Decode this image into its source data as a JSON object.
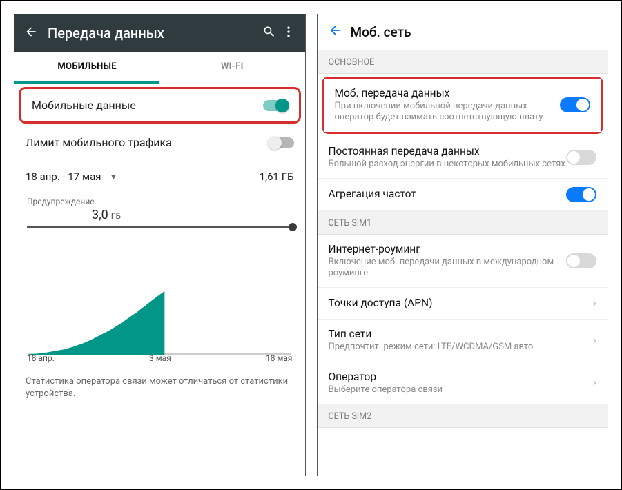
{
  "left": {
    "header": {
      "title": "Передача данных"
    },
    "tabs": {
      "mobile": "МОБИЛЬНЫЕ",
      "wifi": "WI-FI"
    },
    "mobileData": {
      "label": "Мобильные данные"
    },
    "limit": {
      "label": "Лимит мобильного трафика"
    },
    "cycle": {
      "range": "18 апр. - 17 мая",
      "usage": "1,61 ГБ"
    },
    "warning": {
      "label": "Предупреждение",
      "value": "3,0",
      "unit": "ГБ"
    },
    "axis": {
      "start": "18 апр.",
      "mid": "3 мая",
      "end": "18 мая"
    },
    "disclaimer": "Статистика оператора связи может отличаться от статистики устройства."
  },
  "right": {
    "header": {
      "title": "Моб. сеть"
    },
    "section_main": "ОСНОВНОЕ",
    "mobData": {
      "title": "Моб. передача данных",
      "sub": "При включении мобильной передачи данных оператор будет взимать соответствующую плату"
    },
    "alwaysOn": {
      "title": "Постоянная передача данных",
      "sub": "Большой расход энергии в некоторых мобильных сетях"
    },
    "aggregation": {
      "title": "Агрегация частот"
    },
    "section_sim1": "СЕТЬ SIM1",
    "roaming": {
      "title": "Интернет-роуминг",
      "sub": "Включение моб. передачи данных в международном роуминге"
    },
    "apn": {
      "title": "Точки доступа (APN)"
    },
    "netType": {
      "title": "Тип сети",
      "sub": "Предпочтит. режим сети: LTE/WCDMA/GSM авто"
    },
    "operator": {
      "title": "Оператор",
      "sub": "Выберите оператора связи"
    },
    "section_sim2": "СЕТЬ SIM2"
  },
  "chart_data": {
    "type": "area",
    "title": "",
    "xlabel": "",
    "ylabel": "ГБ",
    "ylim": [
      0,
      3
    ],
    "warning_line": 3.0,
    "x_ticks": [
      "18 апр.",
      "3 мая",
      "18 мая"
    ],
    "x_days": [
      0,
      15,
      29
    ],
    "series": [
      {
        "name": "usage",
        "x_days": [
          0,
          1,
          2,
          3,
          4,
          5,
          6,
          7,
          8,
          9,
          10,
          11,
          12,
          13,
          14,
          15
        ],
        "values_gb": [
          0.0,
          0.02,
          0.05,
          0.09,
          0.13,
          0.2,
          0.28,
          0.38,
          0.5,
          0.62,
          0.76,
          0.92,
          1.08,
          1.26,
          1.44,
          1.61
        ]
      }
    ]
  }
}
